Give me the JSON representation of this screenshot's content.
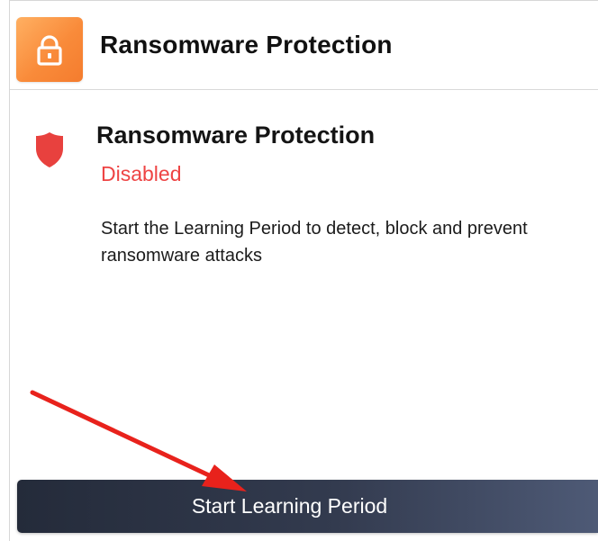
{
  "header": {
    "title": "Ransomware Protection",
    "icon": "lock-icon",
    "icon_gradient": [
      "#ffb062",
      "#f47c2e"
    ]
  },
  "feature": {
    "icon": "shield-icon",
    "icon_color": "#e8413e",
    "title": "Ransomware Protection",
    "status": "Disabled",
    "status_color": "#ee4444",
    "description": "Start the Learning Period to detect, block and prevent ransomware attacks"
  },
  "actions": {
    "start_label": "Start Learning Period",
    "button_colors": [
      "#242b3a",
      "#4e5a76"
    ]
  },
  "annotation": {
    "type": "arrow",
    "color": "#e8221c",
    "points_to": "start-learning-period-button"
  }
}
